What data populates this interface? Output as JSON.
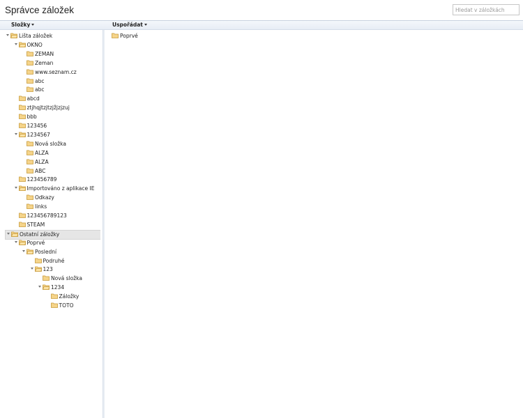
{
  "header": {
    "title": "Správce záložek",
    "search_placeholder": "Hledat v záložkách"
  },
  "toolbar": {
    "folders_label": "Složky",
    "organize_label": "Uspořádat"
  },
  "tree": [
    {
      "label": "Lišta záložek",
      "depth": 0,
      "expanded": true
    },
    {
      "label": "OKNO",
      "depth": 1,
      "expanded": true
    },
    {
      "label": "ZEMAN",
      "depth": 2
    },
    {
      "label": "Zeman",
      "depth": 2
    },
    {
      "label": "www.seznam.cz",
      "depth": 2
    },
    {
      "label": "abc",
      "depth": 2
    },
    {
      "label": "abc",
      "depth": 2
    },
    {
      "label": "abcd",
      "depth": 1
    },
    {
      "label": "ztjhqjtzjtzjžjzjzuj",
      "depth": 1
    },
    {
      "label": "bbb",
      "depth": 1
    },
    {
      "label": "123456",
      "depth": 1
    },
    {
      "label": "1234567",
      "depth": 1,
      "expanded": true
    },
    {
      "label": "Nová složka",
      "depth": 2
    },
    {
      "label": "ALZA",
      "depth": 2
    },
    {
      "label": "ALZA",
      "depth": 2
    },
    {
      "label": "ABC",
      "depth": 2
    },
    {
      "label": "123456789",
      "depth": 1
    },
    {
      "label": "Importováno z aplikace IE",
      "depth": 1,
      "expanded": true
    },
    {
      "label": "Odkazy",
      "depth": 2
    },
    {
      "label": "links",
      "depth": 2
    },
    {
      "label": "123456789123",
      "depth": 1
    },
    {
      "label": "STEAM",
      "depth": 1
    },
    {
      "label": "Ostatní záložky",
      "depth": 0,
      "expanded": true,
      "selected": true
    },
    {
      "label": "Poprvé",
      "depth": 1,
      "expanded": true
    },
    {
      "label": "Poslední",
      "depth": 2,
      "expanded": true
    },
    {
      "label": "Podruhé",
      "depth": 3
    },
    {
      "label": "123",
      "depth": 3,
      "expanded": true
    },
    {
      "label": "Nová složka",
      "depth": 4
    },
    {
      "label": "1234",
      "depth": 4,
      "expanded": true
    },
    {
      "label": "Záložky",
      "depth": 5
    },
    {
      "label": "TOTO",
      "depth": 5
    }
  ],
  "list": [
    {
      "label": "Poprvé"
    }
  ],
  "colors": {
    "folder_fill": "#f5d48a",
    "folder_stroke": "#c79a3a",
    "selected_bg": "#e6e6e6"
  }
}
